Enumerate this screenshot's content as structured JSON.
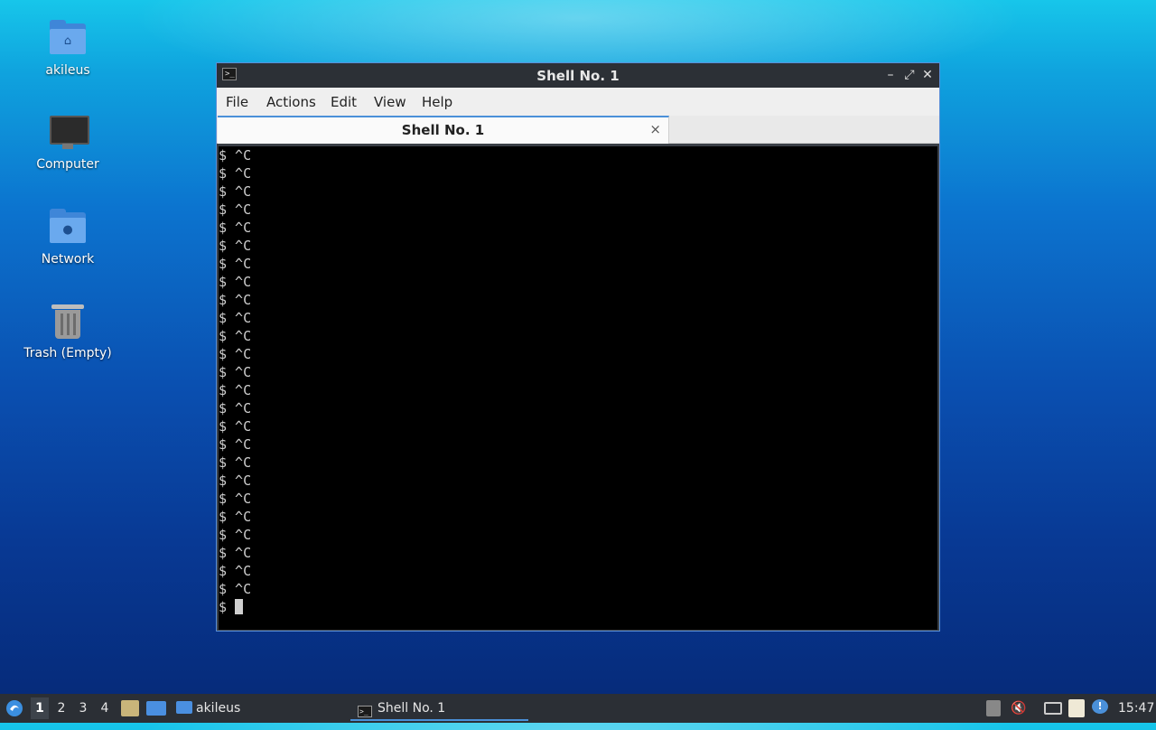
{
  "desktop": {
    "icons": [
      {
        "label": "akileus",
        "icon": "home-folder-icon"
      },
      {
        "label": "Computer",
        "icon": "computer-icon"
      },
      {
        "label": "Network",
        "icon": "network-folder-icon"
      },
      {
        "label": "Trash (Empty)",
        "icon": "trash-icon"
      }
    ]
  },
  "window": {
    "title": "Shell No. 1",
    "menu": [
      "File",
      "Actions",
      "Edit",
      "View",
      "Help"
    ],
    "tab_label": "Shell No. 1",
    "tab_close": "×",
    "terminal_lines": [
      "$ ^C",
      "$ ^C",
      "$ ^C",
      "$ ^C",
      "$ ^C",
      "$ ^C",
      "$ ^C",
      "$ ^C",
      "$ ^C",
      "$ ^C",
      "$ ^C",
      "$ ^C",
      "$ ^C",
      "$ ^C",
      "$ ^C",
      "$ ^C",
      "$ ^C",
      "$ ^C",
      "$ ^C",
      "$ ^C",
      "$ ^C",
      "$ ^C",
      "$ ^C",
      "$ ^C",
      "$ ^C"
    ],
    "prompt": "$ "
  },
  "taskbar": {
    "workspaces": [
      "1",
      "2",
      "3",
      "4"
    ],
    "active_workspace": "1",
    "folder_task": "akileus",
    "shell_task": "Shell No. 1",
    "clock": "15:47"
  },
  "colors": {
    "accent": "#4a90d9",
    "terminal_bg": "#000000",
    "panel_bg": "#2b2f35"
  }
}
